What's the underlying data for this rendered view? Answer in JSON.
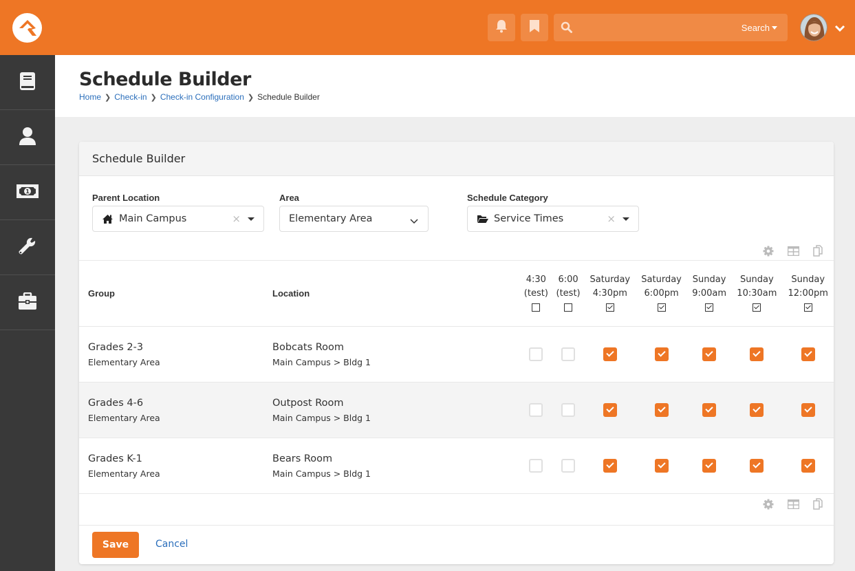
{
  "topbar": {
    "search_placeholder": "",
    "search_label": "Search",
    "accent": "#ee7625"
  },
  "sidebar": {
    "items": [
      {
        "icon": "book-icon"
      },
      {
        "icon": "user-icon"
      },
      {
        "icon": "money-icon"
      },
      {
        "icon": "wrench-icon"
      },
      {
        "icon": "briefcase-icon"
      }
    ]
  },
  "page": {
    "title": "Schedule Builder",
    "breadcrumb": [
      "Home",
      "Check-in",
      "Check-in Configuration",
      "Schedule Builder"
    ]
  },
  "panel": {
    "title": "Schedule Builder",
    "filters": {
      "parent_location": {
        "label": "Parent Location",
        "value": "Main Campus"
      },
      "area": {
        "label": "Area",
        "value": "Elementary Area"
      },
      "schedule_category": {
        "label": "Schedule Category",
        "value": "Service Times"
      }
    },
    "grid": {
      "columns": {
        "group": "Group",
        "location": "Location",
        "schedules": [
          {
            "line1": "4:30",
            "line2": "(test)",
            "all_checked": false
          },
          {
            "line1": "6:00",
            "line2": "(test)",
            "all_checked": false
          },
          {
            "line1": "Saturday",
            "line2": "4:30pm",
            "all_checked": true
          },
          {
            "line1": "Saturday",
            "line2": "6:00pm",
            "all_checked": true
          },
          {
            "line1": "Sunday",
            "line2": "9:00am",
            "all_checked": true
          },
          {
            "line1": "Sunday",
            "line2": "10:30am",
            "all_checked": true
          },
          {
            "line1": "Sunday",
            "line2": "12:00pm",
            "all_checked": true
          }
        ]
      },
      "rows": [
        {
          "group": "Grades 2-3",
          "group_sub": "Elementary Area",
          "location": "Bobcats Room",
          "location_sub": "Main Campus > Bldg 1",
          "checks": [
            false,
            false,
            true,
            true,
            true,
            true,
            true
          ]
        },
        {
          "group": "Grades 4-6",
          "group_sub": "Elementary Area",
          "location": "Outpost Room",
          "location_sub": "Main Campus > Bldg 1",
          "checks": [
            false,
            false,
            true,
            true,
            true,
            true,
            true
          ]
        },
        {
          "group": "Grades K-1",
          "group_sub": "Elementary Area",
          "location": "Bears Room",
          "location_sub": "Main Campus > Bldg 1",
          "checks": [
            false,
            false,
            true,
            true,
            true,
            true,
            true
          ]
        }
      ]
    },
    "actions": {
      "save": "Save",
      "cancel": "Cancel"
    }
  }
}
